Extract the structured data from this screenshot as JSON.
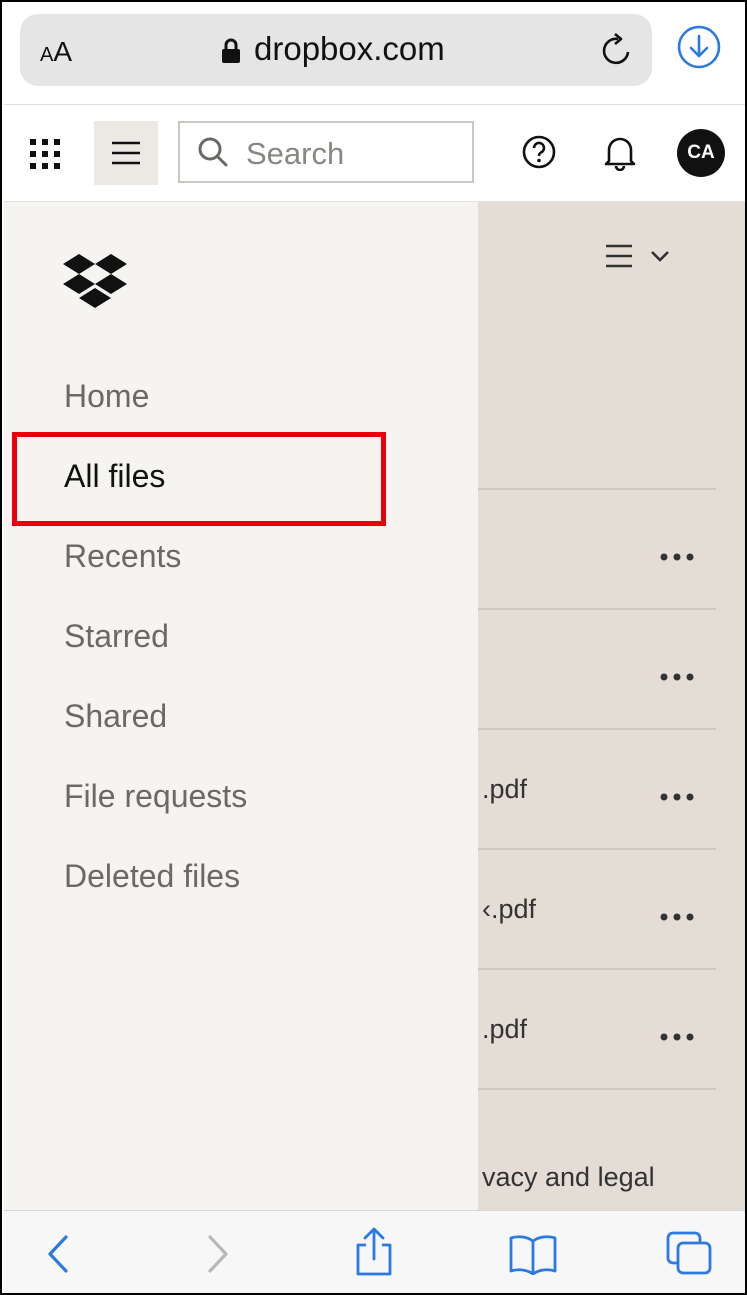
{
  "browser": {
    "aa_small": "A",
    "aa_large": "A",
    "url": "dropbox.com",
    "accent": "#2a7ae2"
  },
  "header": {
    "search_placeholder": "Search",
    "avatar_initials": "CA"
  },
  "sidebar": {
    "items": [
      {
        "label": "Home",
        "active": false
      },
      {
        "label": "All files",
        "active": true
      },
      {
        "label": "Recents",
        "active": false
      },
      {
        "label": "Starred",
        "active": false
      },
      {
        "label": "Shared",
        "active": false
      },
      {
        "label": "File requests",
        "active": false
      },
      {
        "label": "Deleted files",
        "active": false
      }
    ]
  },
  "files": {
    "rows": [
      {
        "name": ""
      },
      {
        "name": ""
      },
      {
        "name": ".pdf"
      },
      {
        "name": "‹.pdf"
      },
      {
        "name": ".pdf"
      }
    ],
    "footer_text": "vacy and legal"
  },
  "colors": {
    "highlight": "#e8000b",
    "drawer_bg": "#f5f4f1",
    "content_bg": "#e3ddd5"
  }
}
